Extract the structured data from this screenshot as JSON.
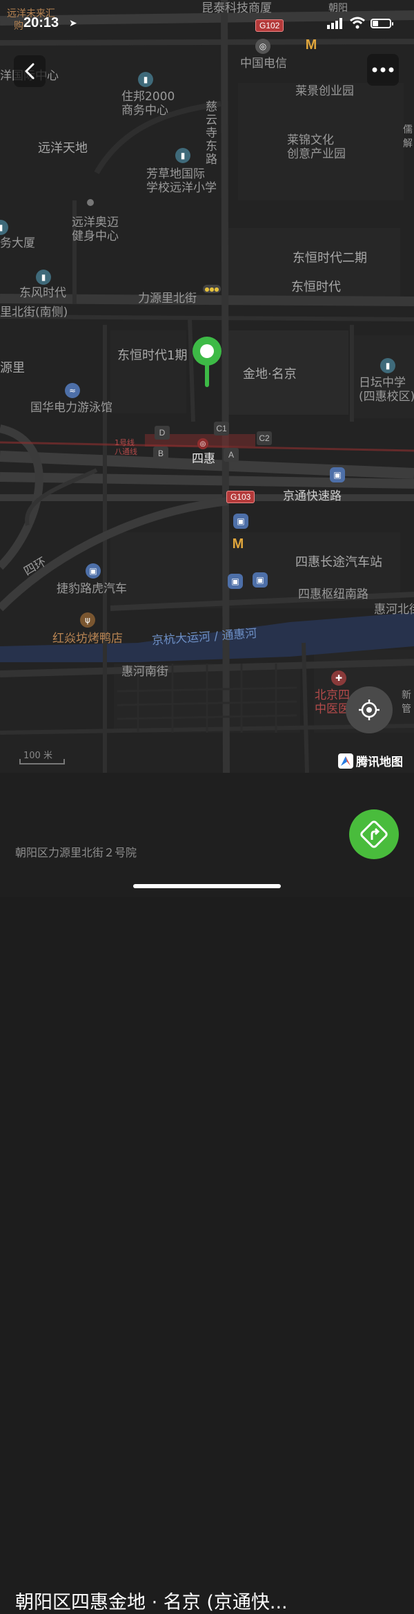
{
  "status_bar": {
    "time": "20:13"
  },
  "map_labels": {
    "top_left_partial": "远洋未来汇",
    "top_left_partial2": "购",
    "kunta": "昆泰科技商厦",
    "g102": "G102",
    "chaoyang_partial": "朝阳",
    "china_telecom": "中国电信",
    "yang_building": "洋国际中心",
    "zhubang": "住邦2000\n商务中心",
    "laijing": "莱景创业园",
    "ciyunsi": "慈\n云\n寺\n东\n路",
    "yuanyang_tiandi": "远洋天地",
    "laijin": "莱锦文化\n创意产业园",
    "right_partial": "儒\n解",
    "fangcaodi": "芳草地国际\n学校远洋小学",
    "yuanyang_aodi": "远洋奥迈\n健身中心",
    "wu_dasha": "务大厦",
    "dongheng2": "东恒时代二期",
    "dongfeng": "东风时代",
    "dongheng": "东恒时代",
    "liyuanli": "力源里北街",
    "liyuanli_south": "里北街(南侧)",
    "dongheng1": "东恒时代1期",
    "jindi": "金地·名京",
    "yuanli": "源里",
    "ritan": "日坛中学\n(四惠校区)",
    "guohua": "国华电力游泳馆",
    "line1": "1号线\n八通线",
    "sihui": "四惠",
    "g103": "G103",
    "jingtong": "京通快速路",
    "sihui_bus": "四惠长途汽车站",
    "sihuan": "四环",
    "jiebao": "捷豹路虎汽车",
    "sihui_hub": "四惠枢纽南路",
    "huihe_north": "惠河北街",
    "hongyan": "红焱坊烤鸭店",
    "canal": "京杭大运河 / 通惠河",
    "huihe_south": "惠河南街",
    "beijing_tcm": "北京四\n中医医",
    "xin_partial": "新\n管",
    "exit_d": "D",
    "exit_b": "B",
    "exit_c1": "C1",
    "exit_c2": "C2",
    "exit_a": "A"
  },
  "map_controls": {
    "scale": "100 米",
    "brand": "腾讯地图"
  },
  "place": {
    "title": "朝阳区四惠金地 · 名京 (京通快...",
    "address": "朝阳区力源里北街２号院"
  },
  "colors": {
    "pin": "#3dba46",
    "nav_button": "#49bc3c",
    "map_bg": "#222222",
    "road": "#3a3a3a",
    "river": "#27324c",
    "rail": "#8f2e2e"
  }
}
